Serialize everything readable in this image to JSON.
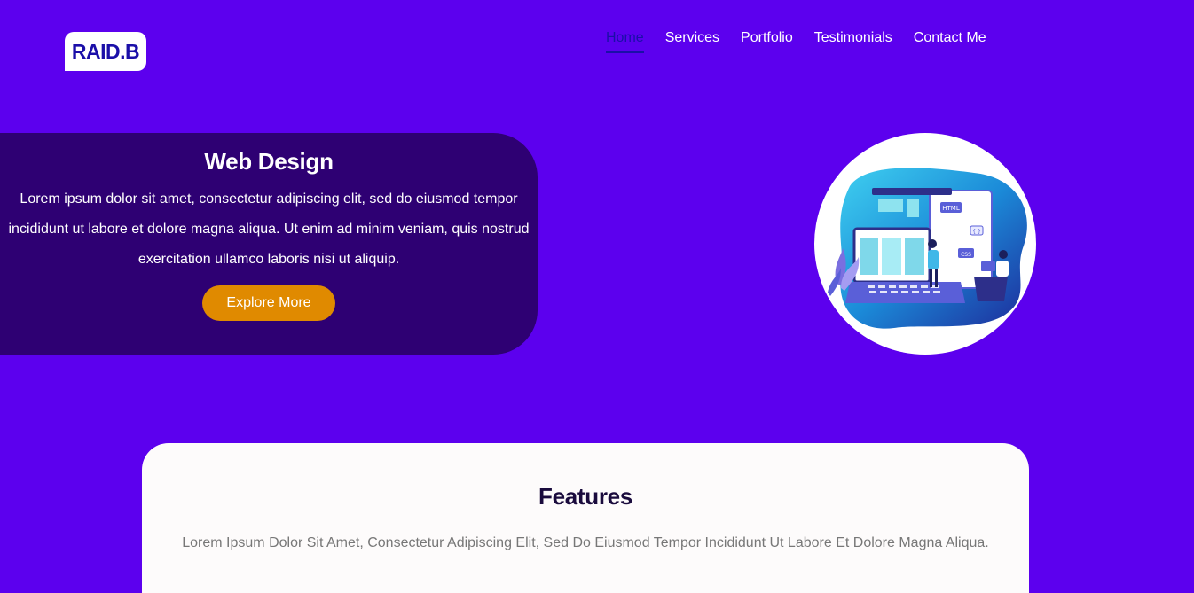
{
  "brand": {
    "logo_text": "RAID.B"
  },
  "nav": {
    "items": [
      {
        "label": "Home",
        "active": true
      },
      {
        "label": "Services"
      },
      {
        "label": "Portfolio"
      },
      {
        "label": "Testimonials"
      },
      {
        "label": "Contact Me"
      }
    ]
  },
  "hero": {
    "title": "Web Design",
    "text": "Lorem ipsum dolor sit amet, consectetur adipiscing elit, sed do eiusmod tempor incididunt ut labore et dolore magna aliqua. Ut enim ad minim veniam, quis nostrud exercitation ullamco laboris nisi ut aliquip.",
    "button_label": "Explore More",
    "illustration_labels": {
      "html": "HTML",
      "css": "CSS",
      "braces": "{ }"
    }
  },
  "features": {
    "title": "Features",
    "text": "Lorem Ipsum Dolor Sit Amet, Consectetur Adipiscing Elit, Sed Do Eiusmod Tempor Incididunt Ut Labore Et Dolore Magna Aliqua."
  },
  "colors": {
    "background": "#5c00ee",
    "hero_card": "#2e0073",
    "accent_button": "#e08a00",
    "logo_text": "#1b0fa8"
  }
}
